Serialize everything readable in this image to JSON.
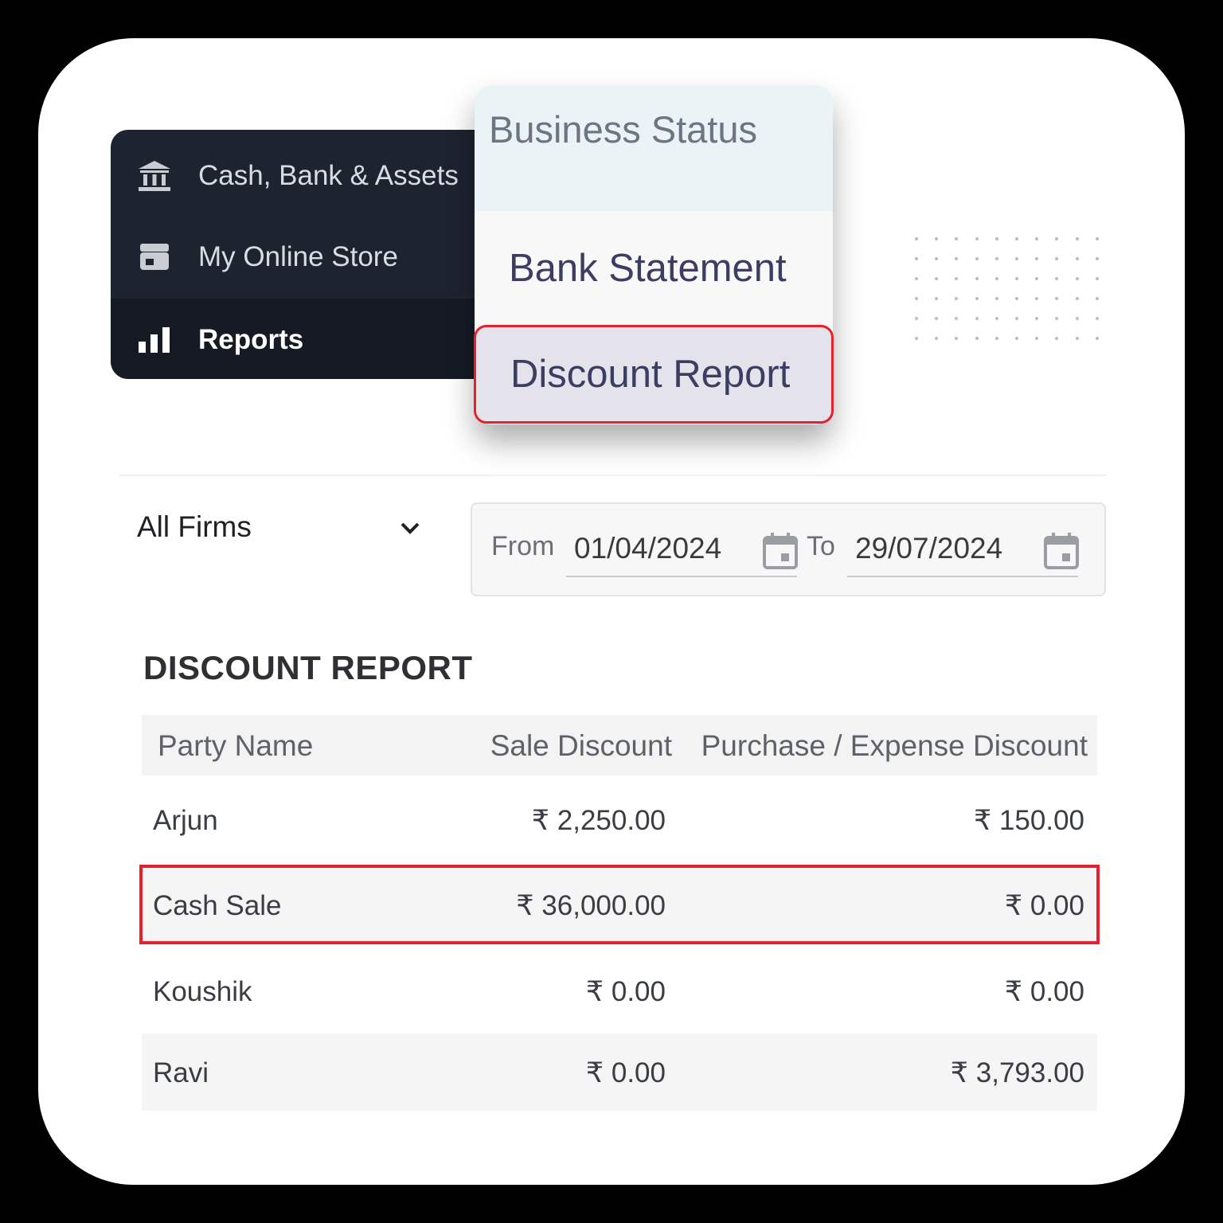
{
  "sidebar": {
    "items": [
      {
        "label": "Cash, Bank & Assets",
        "icon": "bank-icon"
      },
      {
        "label": "My Online Store",
        "icon": "store-icon"
      },
      {
        "label": "Reports",
        "icon": "bar-chart-icon",
        "active": true
      }
    ]
  },
  "menu": {
    "header": "Business Status",
    "items": [
      {
        "label": "Bank Statement"
      },
      {
        "label": "Discount Report",
        "selected": true
      }
    ]
  },
  "filters": {
    "firm": "All Firms",
    "from_label": "From",
    "from_date": "01/04/2024",
    "to_label": "To",
    "to_date": "29/07/2024"
  },
  "report": {
    "title": "DISCOUNT REPORT",
    "columns": [
      "Party Name",
      "Sale Discount",
      "Purchase / Expense Discount"
    ],
    "rows": [
      {
        "name": "Arjun",
        "sale": "₹ 2,250.00",
        "purchase": "₹ 150.00"
      },
      {
        "name": "Cash Sale",
        "sale": "₹ 36,000.00",
        "purchase": "₹ 0.00"
      },
      {
        "name": "Koushik",
        "sale": "₹ 0.00",
        "purchase": "₹ 0.00"
      },
      {
        "name": "Ravi",
        "sale": "₹ 0.00",
        "purchase": "₹ 3,793.00"
      }
    ]
  },
  "colors": {
    "sidebar_bg": "#1e2330",
    "highlight": "#e3222e",
    "menu_text": "#3c3d62"
  }
}
